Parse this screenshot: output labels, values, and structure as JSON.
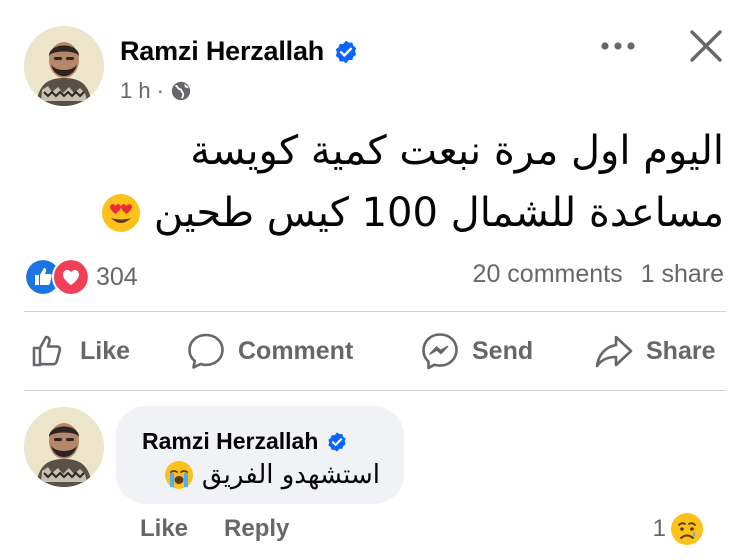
{
  "post": {
    "author": "Ramzi Herzallah",
    "time": "1 h",
    "separator": "·",
    "text_line1": "اليوم اول مرة نبعت كمية كويسة",
    "text_line2": "مساعدة للشمال 100 كيس طحين",
    "text_emoji": "heart-eyes-emoji"
  },
  "stats": {
    "reaction_icons": [
      "like-icon",
      "love-icon"
    ],
    "reaction_count": "304",
    "comments": "20 comments",
    "shares": "1 share"
  },
  "actions": {
    "like": "Like",
    "comment": "Comment",
    "send": "Send",
    "share": "Share"
  },
  "comment": {
    "author": "Ramzi Herzallah",
    "text": "استشهدو الفريق",
    "emoji": "loudly-crying-emoji",
    "like_label": "Like",
    "reply_label": "Reply",
    "reaction_count": "1",
    "reaction_icon": "sad-tear-icon"
  },
  "colors": {
    "verified_blue": "#0866ff",
    "like_blue": "#1b74e4",
    "love_red": "#f33e58",
    "secondary_text": "#65676b",
    "bubble_bg": "#f0f2f5"
  }
}
